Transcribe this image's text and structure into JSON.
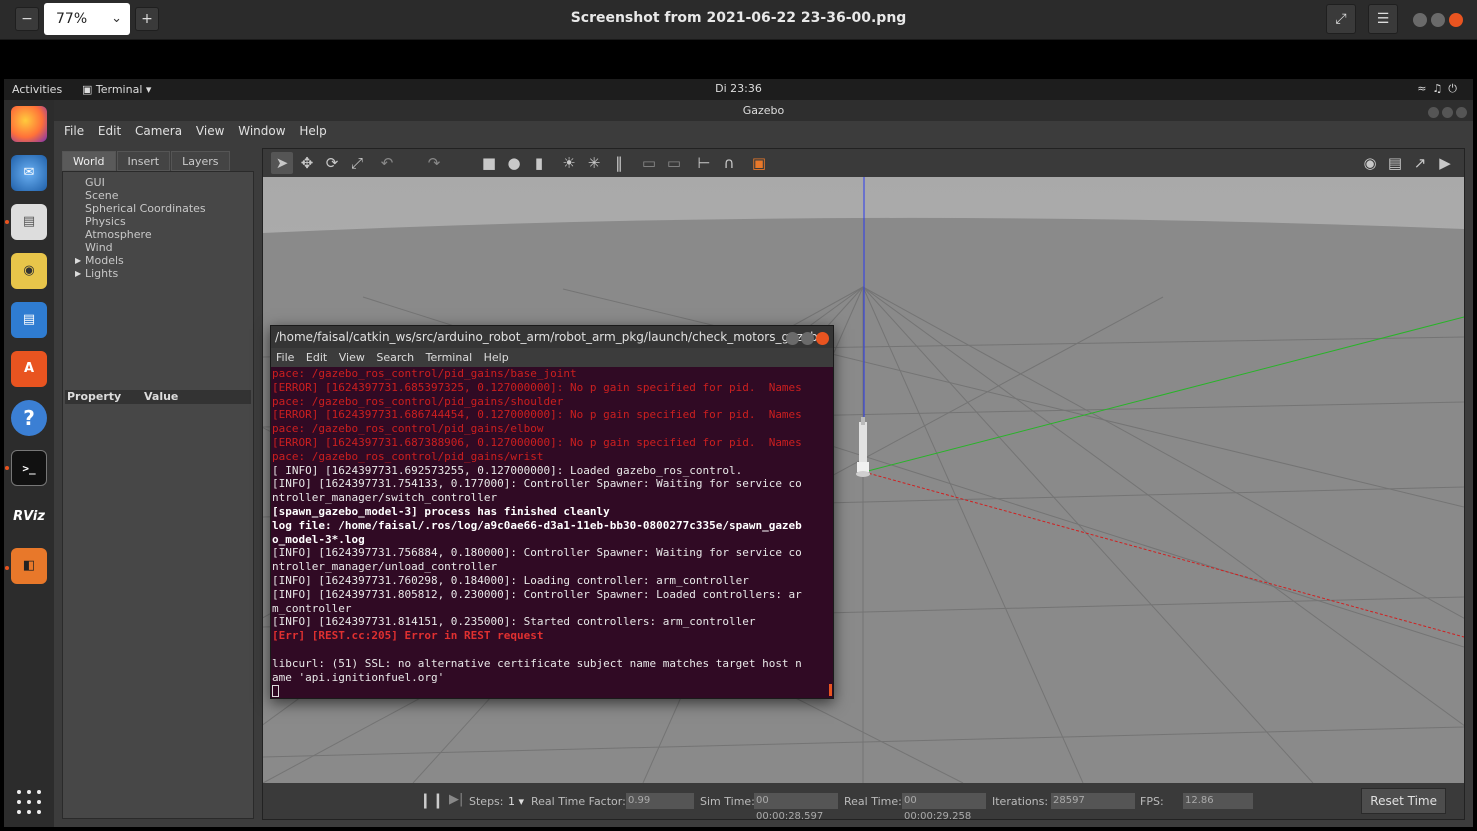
{
  "viewer": {
    "zoom": "77%",
    "title": "Screenshot from 2021-06-22 23-36-00.png",
    "zoom_out": "−",
    "zoom_in": "+"
  },
  "topbar": {
    "activities": "Activities",
    "app_menu": "Terminal ▾",
    "clock": "Di 23:36"
  },
  "gazebo": {
    "window_title": "Gazebo",
    "menu": [
      "File",
      "Edit",
      "Camera",
      "View",
      "Window",
      "Help"
    ],
    "tabs": [
      "World",
      "Insert",
      "Layers"
    ],
    "tree": [
      "GUI",
      "Scene",
      "Spherical Coordinates",
      "Physics",
      "Atmosphere",
      "Wind",
      "Models",
      "Lights"
    ],
    "property_header": "Property",
    "value_header": "Value",
    "bottom": {
      "steps_label": "Steps:",
      "steps_value": "1",
      "rtf_label": "Real Time Factor:",
      "rtf_value": "0.99",
      "sim_time_label": "Sim Time:",
      "sim_time_value": "00 00:00:28.597",
      "real_time_label": "Real Time:",
      "real_time_value": "00 00:00:29.258",
      "iterations_label": "Iterations:",
      "iterations_value": "28597",
      "fps_label": "FPS:",
      "fps_value": "12.86",
      "reset_label": "Reset Time"
    }
  },
  "terminal": {
    "title": "/home/faisal/catkin_ws/src/arduino_robot_arm/robot_arm_pkg/launch/check_motors_gazeb...",
    "menu": [
      "File",
      "Edit",
      "View",
      "Search",
      "Terminal",
      "Help"
    ],
    "lines": [
      "pace: /gazebo_ros_control/pid_gains/base_joint",
      "[ERROR] [1624397731.685397325, 0.127000000]: No p gain specified for pid.  Names",
      "pace: /gazebo_ros_control/pid_gains/shoulder",
      "[ERROR] [1624397731.686744454, 0.127000000]: No p gain specified for pid.  Names",
      "pace: /gazebo_ros_control/pid_gains/elbow",
      "[ERROR] [1624397731.687388906, 0.127000000]: No p gain specified for pid.  Names",
      "pace: /gazebo_ros_control/pid_gains/wrist",
      "[ INFO] [1624397731.692573255, 0.127000000]: Loaded gazebo_ros_control.",
      "[INFO] [1624397731.754133, 0.177000]: Controller Spawner: Waiting for service co",
      "ntroller_manager/switch_controller",
      "[spawn_gazebo_model-3] process has finished cleanly",
      "log file: /home/faisal/.ros/log/a9c0ae66-d3a1-11eb-bb30-0800277c335e/spawn_gazeb",
      "o_model-3*.log",
      "[INFO] [1624397731.756884, 0.180000]: Controller Spawner: Waiting for service co",
      "ntroller_manager/unload_controller",
      "[INFO] [1624397731.760298, 0.184000]: Loading controller: arm_controller",
      "[INFO] [1624397731.805812, 0.230000]: Controller Spawner: Loaded controllers: ar",
      "m_controller",
      "[INFO] [1624397731.814151, 0.235000]: Started controllers: arm_controller",
      "[Err] [REST.cc:205] Error in REST request",
      "",
      "libcurl: (51) SSL: no alternative certificate subject name matches target host n",
      "ame 'api.ignitionfuel.org'"
    ]
  },
  "colors": {
    "terminal_bg": "#300a24",
    "error_red": "#cc1f1f",
    "ubuntu_orange": "#e95420"
  },
  "dock_icons": [
    "firefox-icon",
    "thunderbird-icon",
    "files-icon",
    "rhythmbox-icon",
    "writer-icon",
    "software-icon",
    "help-icon",
    "terminal-icon",
    "rviz-icon",
    "gazebo-icon"
  ]
}
